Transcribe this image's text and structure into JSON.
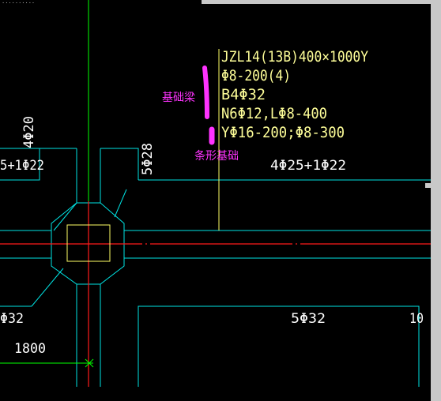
{
  "title_fragment": "..........",
  "beam_annotation": {
    "lines": [
      "JZL14(13B)400×1000Y",
      "Φ8-200(4)",
      "B4Φ32",
      "N6Φ12,LΦ8-400",
      "YΦ16-200;Φ8-300"
    ]
  },
  "callouts": {
    "beam_label": "基础梁",
    "strip_label": "条形基础"
  },
  "rebar_labels": {
    "left_vertical": "4Φ20",
    "left_top": "5+1Φ22",
    "mid_vertical": "5Φ28",
    "right_top": "4Φ25+1Φ22",
    "left_bottom": "Φ32",
    "right_bottom": "5Φ32",
    "far_right_bottom": "10",
    "dimension": "1800"
  },
  "colors": {
    "background": "#000000",
    "beam_outline": "#00e5e5",
    "axis_green": "#00ff00",
    "axis_red": "#ff1a1a",
    "column": "#ffff66",
    "annotation_text": "#ffff99",
    "callout": "#ff33ff",
    "panel_gray": "#c8c8c8"
  }
}
